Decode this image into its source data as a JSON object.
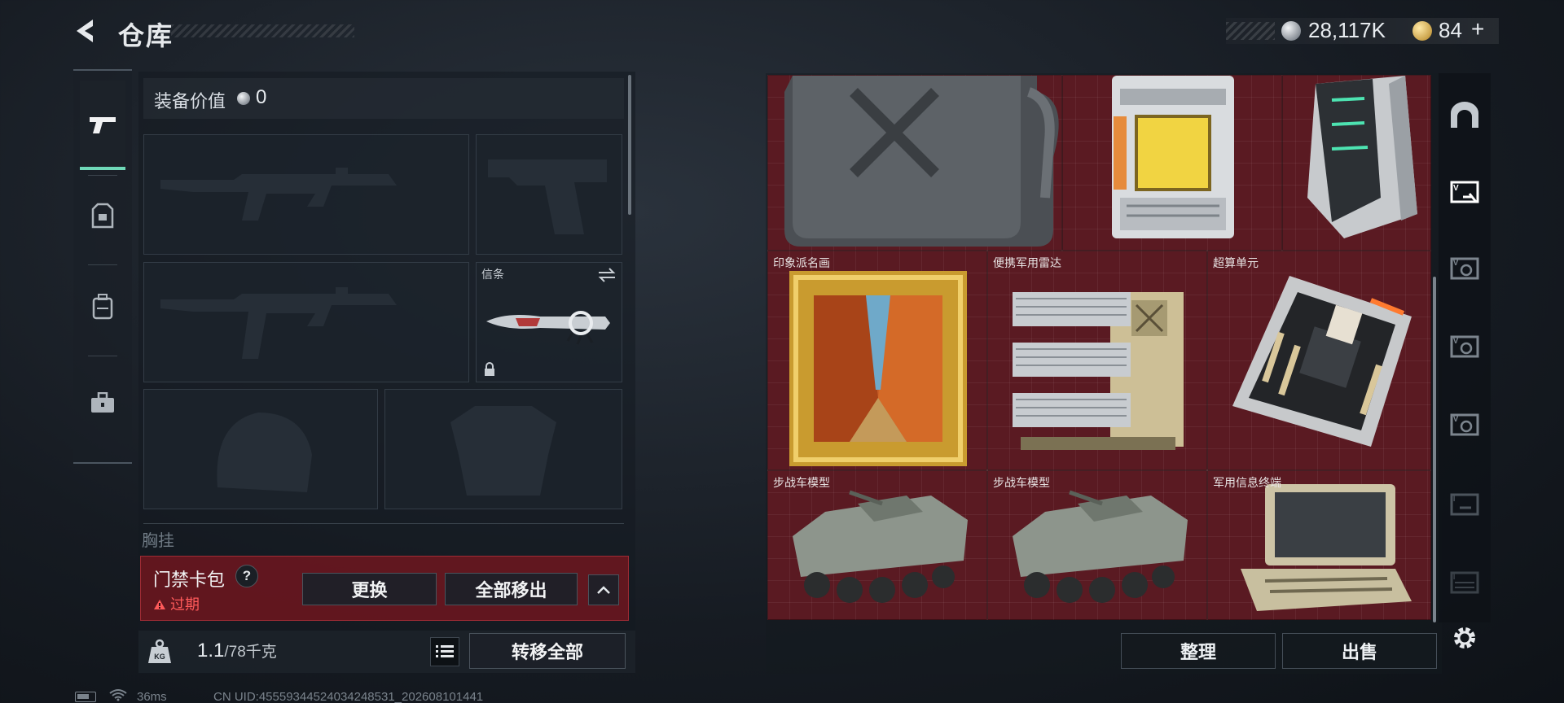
{
  "header": {
    "title": "仓库",
    "silver_amount": "28,117K",
    "gold_amount": "84",
    "gold_plus": "+"
  },
  "tabs": [
    {
      "name": "weapons",
      "icon": "pistol-icon",
      "active": true
    },
    {
      "name": "armor",
      "icon": "armor-icon",
      "active": false
    },
    {
      "name": "backpack",
      "icon": "backpack-icon",
      "active": false
    },
    {
      "name": "toolbox",
      "icon": "briefcase-icon",
      "active": false
    }
  ],
  "equipment": {
    "value_label": "装备价值",
    "value": "0",
    "melee_slot_label": "信条",
    "section_hint_label": "胸挂"
  },
  "access_card": {
    "title": "门禁卡包",
    "help": "?",
    "expired_label": "过期",
    "replace_label": "更换",
    "move_all_out_label": "全部移出"
  },
  "weight": {
    "current": "1.1",
    "max": "/78千克",
    "transfer_all_label": "转移全部"
  },
  "status_bar": {
    "ping": "36ms",
    "uid": "CN UID:455593445240342485​31_202608101441"
  },
  "storage": {
    "items": [
      {
        "label": "",
        "name": "fuel-can-item"
      },
      {
        "label": "",
        "name": "reactor-core-item"
      },
      {
        "label": "",
        "name": "server-unit-item"
      },
      {
        "label": "印象派名画",
        "name": "impressionist-painting-item"
      },
      {
        "label": "便携军用雷达",
        "name": "portable-radar-item"
      },
      {
        "label": "超算单元",
        "name": "supercomputer-unit-item"
      },
      {
        "label": "步战车模型",
        "name": "ifv-model-item"
      },
      {
        "label": "步战车模型",
        "name": "ifv-model-item-2"
      },
      {
        "label": "军用信息终端",
        "name": "military-terminal-item"
      }
    ],
    "sort_label": "整理",
    "sell_label": "出售"
  },
  "colors": {
    "accent": "#6fd9b8",
    "storage_bg": "#5a1a22",
    "alert": "#ff5a5a"
  }
}
